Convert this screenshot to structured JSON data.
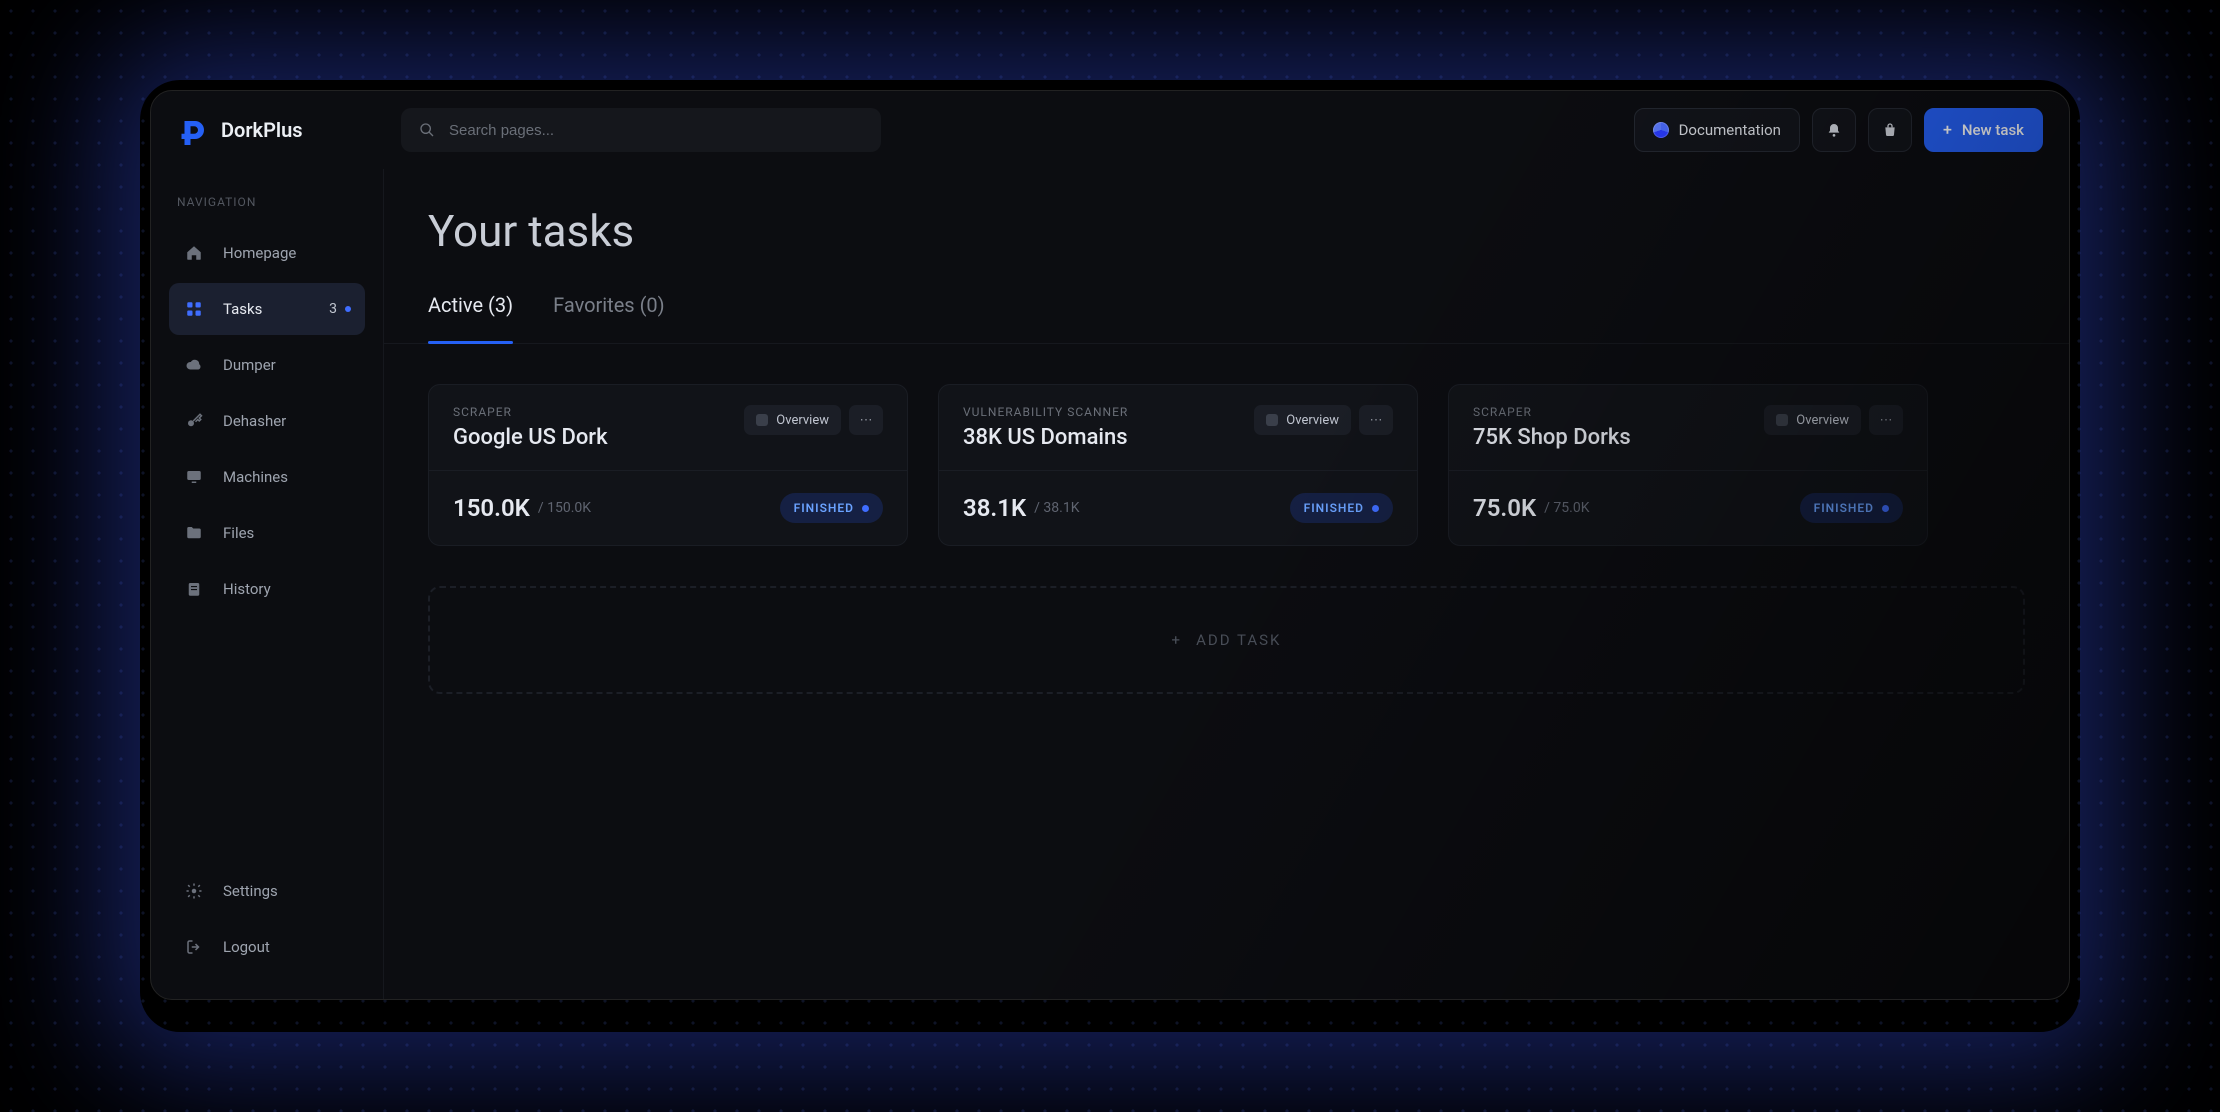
{
  "brand": {
    "name": "DorkPlus"
  },
  "search": {
    "placeholder": "Search pages..."
  },
  "header": {
    "documentation": "Documentation",
    "new_task": "New task"
  },
  "sidebar": {
    "section_label": "NAVIGATION",
    "items": [
      {
        "label": "Homepage"
      },
      {
        "label": "Tasks",
        "badge": "3"
      },
      {
        "label": "Dumper"
      },
      {
        "label": "Dehasher"
      },
      {
        "label": "Machines"
      },
      {
        "label": "Files"
      },
      {
        "label": "History"
      }
    ],
    "footer": [
      {
        "label": "Settings"
      },
      {
        "label": "Logout"
      }
    ]
  },
  "page": {
    "title": "Your tasks"
  },
  "tabs": {
    "active": "Active (3)",
    "favorites": "Favorites (0)"
  },
  "cards": [
    {
      "kicker": "SCRAPER",
      "name": "Google US Dork",
      "overview": "Overview",
      "stat": "150.0K",
      "stat_of": "/ 150.0K",
      "status": "FINISHED"
    },
    {
      "kicker": "VULNERABILITY SCANNER",
      "name": "38K US Domains",
      "overview": "Overview",
      "stat": "38.1K",
      "stat_of": "/ 38.1K",
      "status": "FINISHED"
    },
    {
      "kicker": "SCRAPER",
      "name": "75K Shop Dorks",
      "overview": "Overview",
      "stat": "75.0K",
      "stat_of": "/ 75.0K",
      "status": "FINISHED"
    }
  ],
  "add_task_label": "ADD TASK"
}
